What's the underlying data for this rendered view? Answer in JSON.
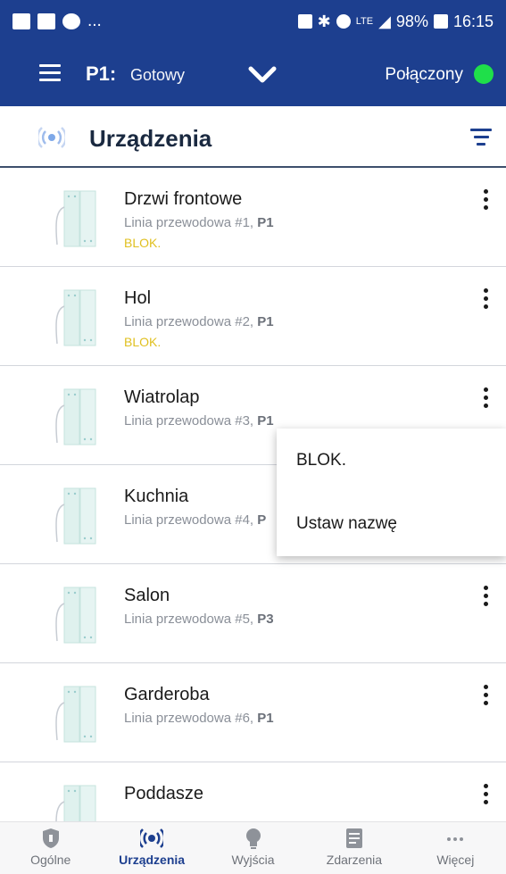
{
  "status_bar": {
    "left_more": "...",
    "battery": "98%",
    "time": "16:15",
    "network": "LTE"
  },
  "app_bar": {
    "panel": "P1:",
    "state": "Gotowy",
    "connection": "Połączony",
    "connection_color": "#1fdf4a",
    "bar_color": "#1d3f8f"
  },
  "section": {
    "title": "Urządzenia"
  },
  "devices": [
    {
      "name": "Drzwi frontowe",
      "line": "Linia przewodowa #1,",
      "partition": "P1",
      "status": "BLOK."
    },
    {
      "name": "Hol",
      "line": "Linia przewodowa #2,",
      "partition": "P1",
      "status": "BLOK."
    },
    {
      "name": "Wiatrolap",
      "line": "Linia przewodowa #3,",
      "partition": "P1",
      "status": ""
    },
    {
      "name": "Kuchnia",
      "line": "Linia przewodowa #4,",
      "partition": "P",
      "status": ""
    },
    {
      "name": "Salon",
      "line": "Linia przewodowa #5,",
      "partition": "P3",
      "status": ""
    },
    {
      "name": "Garderoba",
      "line": "Linia przewodowa #6,",
      "partition": "P1",
      "status": ""
    },
    {
      "name": "Poddasze",
      "line": "",
      "partition": "",
      "status": ""
    }
  ],
  "popup_menu": {
    "items": [
      "BLOK.",
      "Ustaw nazwę"
    ]
  },
  "bottom_nav": {
    "items": [
      {
        "label": "Ogólne",
        "icon": "shield-icon"
      },
      {
        "label": "Urządzenia",
        "icon": "radar-icon"
      },
      {
        "label": "Wyjścia",
        "icon": "bulb-icon"
      },
      {
        "label": "Zdarzenia",
        "icon": "document-icon"
      },
      {
        "label": "Więcej",
        "icon": "more-icon"
      }
    ],
    "active": "Urządzenia"
  }
}
